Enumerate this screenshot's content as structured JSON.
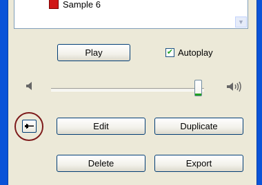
{
  "list": {
    "items": [
      {
        "label": "Sample 6",
        "icon": "audio-file-icon"
      }
    ],
    "scroll_icon": "chevron-down-icon"
  },
  "controls": {
    "play_label": "Play",
    "autoplay_label": "Autoplay",
    "autoplay_checked": true,
    "edit_label": "Edit",
    "duplicate_label": "Duplicate",
    "delete_label": "Delete",
    "export_label": "Export",
    "waveform_icon": "waveform-icon"
  },
  "volume": {
    "low_icon": "speaker-low-icon",
    "high_icon": "speaker-high-icon",
    "level": 0.95
  },
  "colors": {
    "frame": "#0a53d8",
    "panel": "#ece9d8",
    "button_border": "#003c74",
    "highlight": "#7d1a1a",
    "accent_green": "#21a121"
  }
}
